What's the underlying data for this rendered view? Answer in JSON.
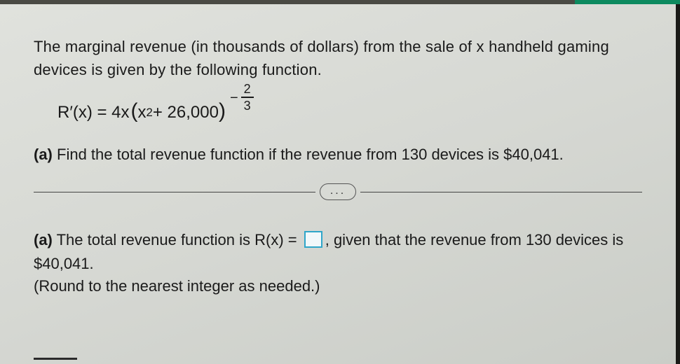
{
  "question": {
    "intro": "The marginal revenue (in thousands of dollars) from the sale of x handheld gaming devices is given by the following function.",
    "formula_lhs": "R′(x) = 4x",
    "formula_paren_open": "(",
    "formula_xsq": "x",
    "formula_plus": " + 26,000",
    "formula_paren_close": ")",
    "exp_neg": "−",
    "exp_num": "2",
    "exp_den": "3",
    "part_a_label": "(a)",
    "part_a_text": " Find the total revenue function if the revenue from 130 devices is $40,041."
  },
  "separator": {
    "dots": "..."
  },
  "answer": {
    "label": "(a)",
    "before_box": " The total revenue function is R(x) = ",
    "after_box": ", given that the revenue from 130 devices is $40,041.",
    "round_note": "(Round to the nearest integer as needed.)",
    "answer_value": ""
  }
}
